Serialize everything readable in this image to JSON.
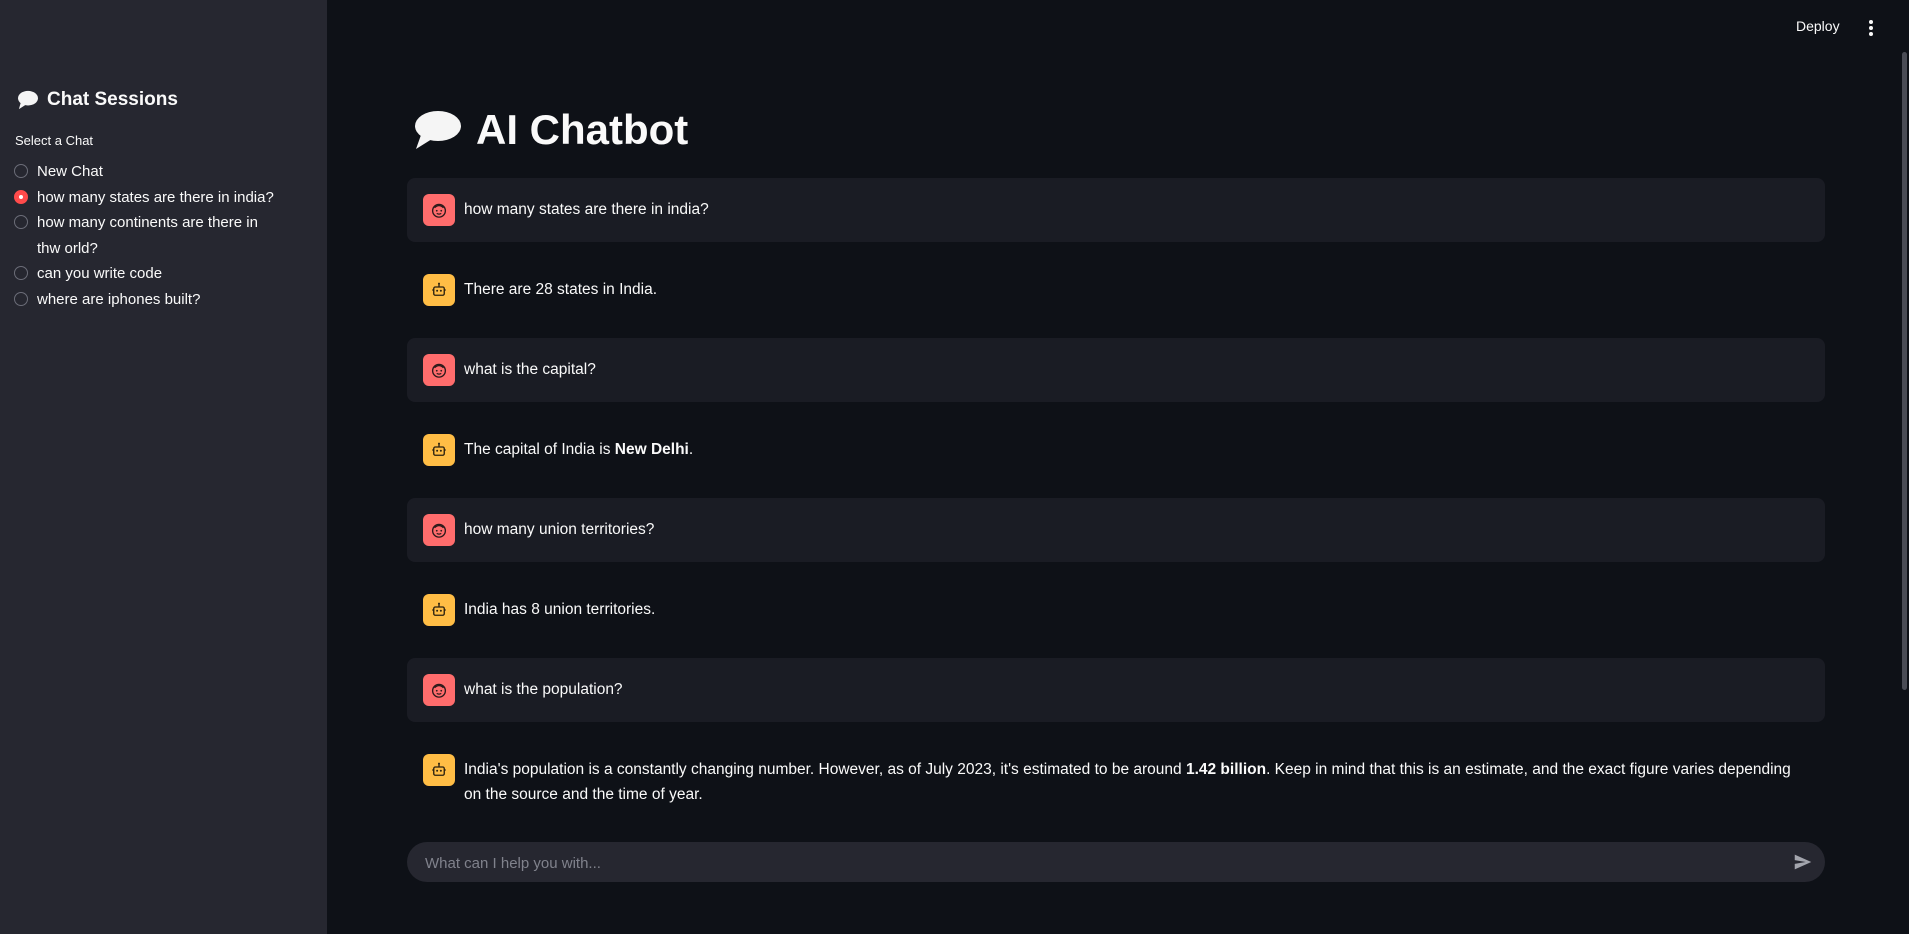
{
  "sidebar": {
    "title": "Chat Sessions",
    "select_label": "Select a Chat",
    "sessions": [
      {
        "label": "New Chat",
        "selected": false
      },
      {
        "label": "how many states are there in india?",
        "selected": true
      },
      {
        "label": "how many continents are there in thw orld?",
        "selected": false
      },
      {
        "label": "can you write code",
        "selected": false
      },
      {
        "label": "where are iphones built?",
        "selected": false
      }
    ]
  },
  "topbar": {
    "deploy_label": "Deploy"
  },
  "main": {
    "title": "AI Chatbot",
    "messages": [
      {
        "role": "user",
        "parts": [
          {
            "text": "how many states are there in india?"
          }
        ]
      },
      {
        "role": "assistant",
        "parts": [
          {
            "text": "There are 28 states in India."
          }
        ]
      },
      {
        "role": "user",
        "parts": [
          {
            "text": "what is the capital?"
          }
        ]
      },
      {
        "role": "assistant",
        "parts": [
          {
            "text": "The capital of India is "
          },
          {
            "text": "New Delhi",
            "bold": true
          },
          {
            "text": "."
          }
        ]
      },
      {
        "role": "user",
        "parts": [
          {
            "text": "how many union territories?"
          }
        ]
      },
      {
        "role": "assistant",
        "parts": [
          {
            "text": "India has 8 union territories."
          }
        ]
      },
      {
        "role": "user",
        "parts": [
          {
            "text": "what is the population?"
          }
        ]
      },
      {
        "role": "assistant",
        "parts": [
          {
            "text": "India's population is a constantly changing number. However, as of July 2023, it's estimated to be around "
          },
          {
            "text": "1.42 billion",
            "bold": true
          },
          {
            "text": ". Keep in mind that this is an estimate, and the exact figure varies depending on the source and the time of year."
          }
        ]
      }
    ]
  },
  "chat_input": {
    "placeholder": "What can I help you with..."
  },
  "colors": {
    "background": "#0e1117",
    "sidebar": "#262730",
    "user_avatar": "#ff6c6c",
    "assistant_avatar": "#ffbd45",
    "accent": "#ff4b4b"
  },
  "icons": {
    "title_icon": "speech-balloon-icon",
    "user_avatar_icon": "face-icon",
    "assistant_avatar_icon": "robot-icon",
    "send_icon": "send-arrow-icon",
    "menu_icon": "vertical-ellipsis-icon"
  }
}
